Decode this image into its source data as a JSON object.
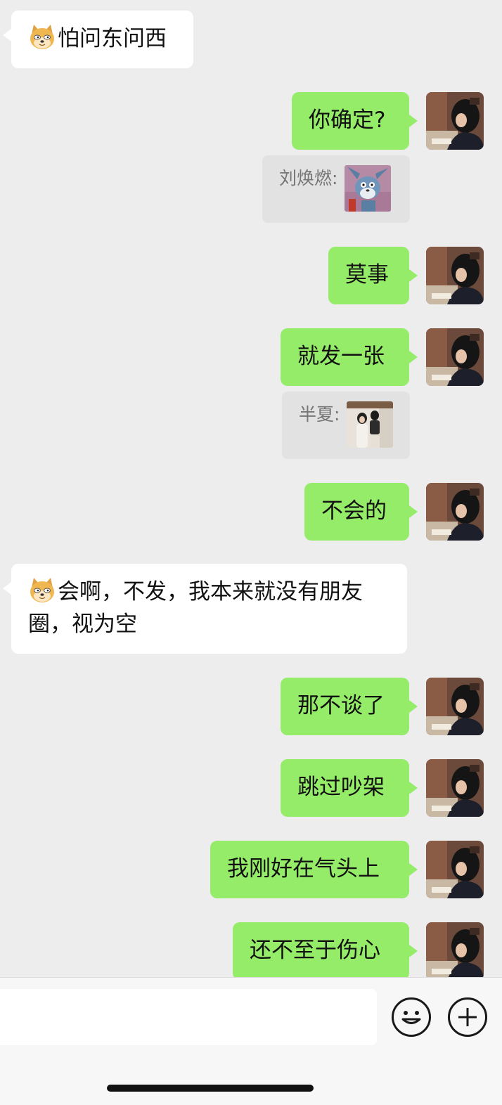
{
  "chat": {
    "messages": [
      {
        "side": "in",
        "has_emoji": true,
        "text": "怕问东问西"
      },
      {
        "side": "out",
        "text": "你确定?"
      },
      {
        "side": "quote",
        "name": "刘焕燃:",
        "thumb": "tom-cat-sticker"
      },
      {
        "side": "out",
        "text": "莫事"
      },
      {
        "side": "out",
        "text": "就发一张"
      },
      {
        "side": "quote",
        "name": "半夏:",
        "thumb": "couple-photo"
      },
      {
        "side": "out",
        "text": "不会的"
      },
      {
        "side": "in",
        "has_emoji": true,
        "text": "会啊，不发，我本来就没有朋友圈，视为空"
      },
      {
        "side": "out",
        "text": "那不谈了"
      },
      {
        "side": "out",
        "text": "跳过吵架"
      },
      {
        "side": "out",
        "text": "我刚好在气头上"
      },
      {
        "side": "out",
        "text": "还不至于伤心"
      }
    ]
  },
  "input_bar": {
    "emoji_button_icon": "smiley-face-icon",
    "plus_button_icon": "plus-circle-icon"
  },
  "colors": {
    "background": "#ededed",
    "outgoing_bubble": "#95ec69",
    "incoming_bubble": "#ffffff",
    "quote_box": "#e2e2e2"
  }
}
